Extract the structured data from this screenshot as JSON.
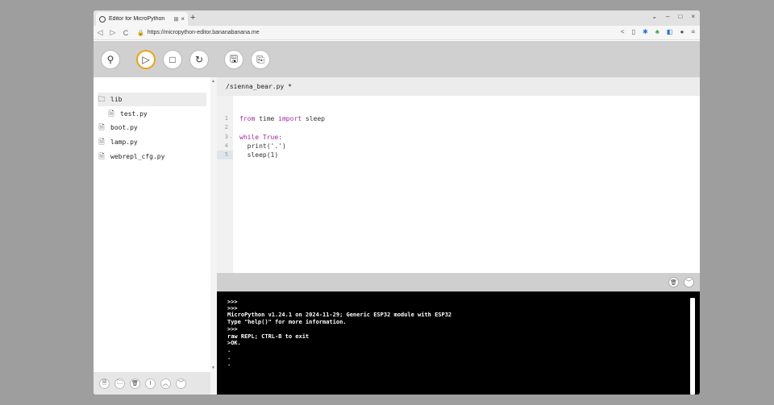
{
  "browser": {
    "tab_title": "Editor for MicroPython",
    "tab_extra_icon": "⊞",
    "tab_close": "×",
    "new_tab": "+",
    "url": "https://micropython-editor.bananabanana.me",
    "nav_back": "◁",
    "nav_forward": "▷",
    "nav_reload": "C",
    "lock": "🔒",
    "win_chevron": "⌄",
    "win_minimize": "–",
    "win_maximize": "□",
    "win_close": "×"
  },
  "toolbar": {
    "connect_icon": "⚲",
    "run_icon": "▷",
    "stop_icon": "□",
    "reset_icon": "↻",
    "save_icon": "🖫",
    "copy_icon": "⎘"
  },
  "files": [
    {
      "name": "lib",
      "icon": "🗀"
    },
    {
      "name": "test.py",
      "icon": "🗎"
    },
    {
      "name": "boot.py",
      "icon": "🗎"
    },
    {
      "name": "lamp.py",
      "icon": "🗎"
    },
    {
      "name": "webrepl_cfg.py",
      "icon": "🗎"
    }
  ],
  "sidebar_actions": [
    "🗎",
    "🗀",
    "🗑",
    "I",
    "︿",
    "﹀"
  ],
  "editor": {
    "file_path": "/sienna_bear.py *",
    "line_numbers": [
      "1",
      "2",
      "3",
      "4",
      "5"
    ],
    "fold_marker": "⌄",
    "code": {
      "l1_kw1": "from",
      "l1_mod": " time ",
      "l1_kw2": "import",
      "l1_name": " sleep",
      "l3_kw": "while",
      "l3_true": " True",
      "l3_colon": ":",
      "l4": "  print('.')",
      "l5": "  sleep(1)"
    }
  },
  "terminal": {
    "clear_icon": "🗑",
    "collapse_icon": "﹀",
    "lines": [
      ">>>",
      ">>>",
      "MicroPython v1.24.1 on 2024-11-29; Generic ESP32 module with ESP32",
      "Type \"help()\" for more information.",
      ">>>",
      "raw REPL; CTRL-B to exit",
      ">OK.",
      ".",
      ".",
      "."
    ]
  },
  "colors": {
    "run_accent": "#f0a30a",
    "keyword": "#a626a4",
    "terminal_bg": "#000000"
  }
}
